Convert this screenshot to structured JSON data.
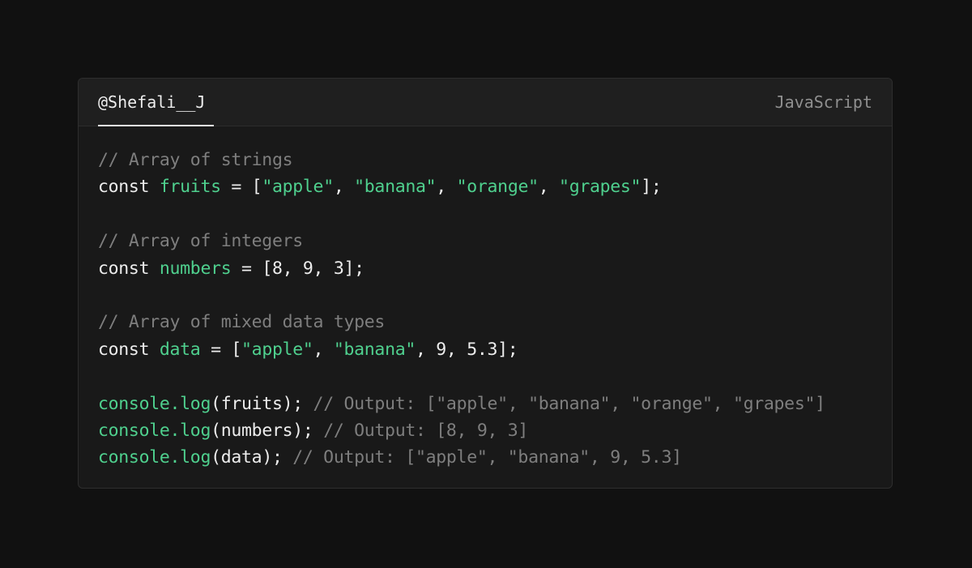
{
  "header": {
    "author": "@Shefali__J",
    "language": "JavaScript"
  },
  "colors": {
    "background": "#111111",
    "card": "#191919",
    "header": "#1f1f1f",
    "text": "#ededed",
    "comment": "#7e7e7e",
    "accent_green": "#4fd08e"
  },
  "code_lines": [
    [
      {
        "t": "comment",
        "v": "// Array of strings"
      }
    ],
    [
      {
        "t": "keyword",
        "v": "const "
      },
      {
        "t": "ident",
        "v": "fruits"
      },
      {
        "t": "plain",
        "v": " = ["
      },
      {
        "t": "string",
        "v": "\"apple\""
      },
      {
        "t": "plain",
        "v": ", "
      },
      {
        "t": "string",
        "v": "\"banana\""
      },
      {
        "t": "plain",
        "v": ", "
      },
      {
        "t": "string",
        "v": "\"orange\""
      },
      {
        "t": "plain",
        "v": ", "
      },
      {
        "t": "string",
        "v": "\"grapes\""
      },
      {
        "t": "plain",
        "v": "];"
      }
    ],
    [],
    [
      {
        "t": "comment",
        "v": "// Array of integers"
      }
    ],
    [
      {
        "t": "keyword",
        "v": "const "
      },
      {
        "t": "ident",
        "v": "numbers"
      },
      {
        "t": "plain",
        "v": " = [8, 9, 3];"
      }
    ],
    [],
    [
      {
        "t": "comment",
        "v": "// Array of mixed data types"
      }
    ],
    [
      {
        "t": "keyword",
        "v": "const "
      },
      {
        "t": "ident",
        "v": "data"
      },
      {
        "t": "plain",
        "v": " = ["
      },
      {
        "t": "string",
        "v": "\"apple\""
      },
      {
        "t": "plain",
        "v": ", "
      },
      {
        "t": "string",
        "v": "\"banana\""
      },
      {
        "t": "plain",
        "v": ", 9, 5.3];"
      }
    ],
    [],
    [
      {
        "t": "fn",
        "v": "console.log"
      },
      {
        "t": "plain",
        "v": "(fruits); "
      },
      {
        "t": "comment",
        "v": "// Output: [\"apple\", \"banana\", \"orange\", \"grapes\"]"
      }
    ],
    [
      {
        "t": "fn",
        "v": "console.log"
      },
      {
        "t": "plain",
        "v": "(numbers); "
      },
      {
        "t": "comment",
        "v": "// Output: [8, 9, 3]"
      }
    ],
    [
      {
        "t": "fn",
        "v": "console.log"
      },
      {
        "t": "plain",
        "v": "(data); "
      },
      {
        "t": "comment",
        "v": "// Output: [\"apple\", \"banana\", 9, 5.3]"
      }
    ]
  ]
}
